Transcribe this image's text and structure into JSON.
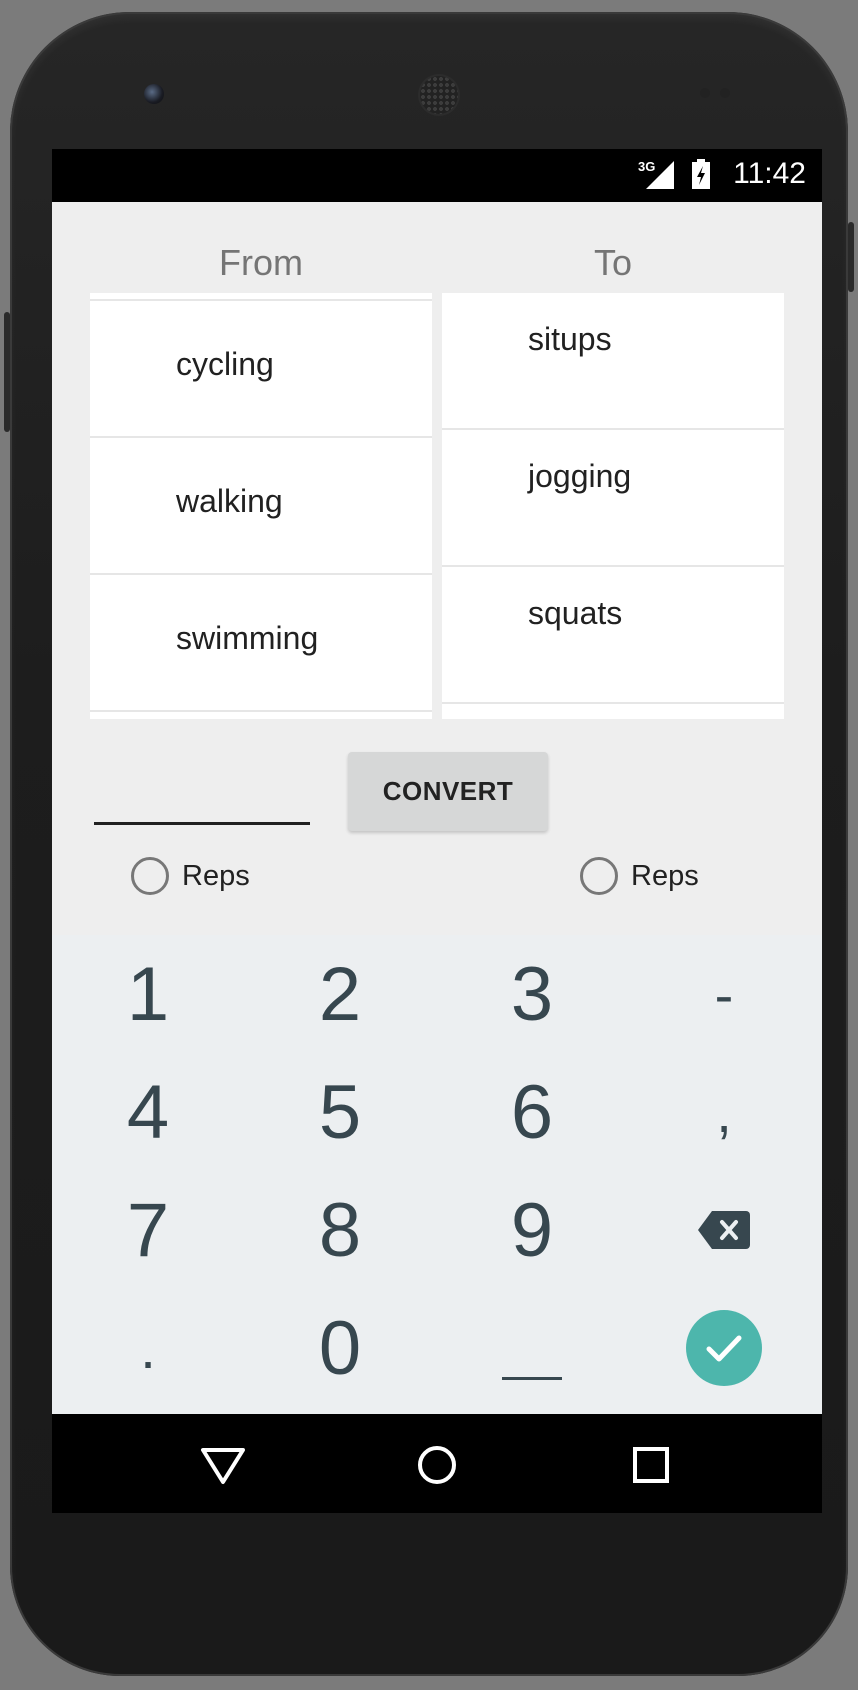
{
  "status_bar": {
    "network": "3G",
    "time": "11:42"
  },
  "converter": {
    "from_header": "From",
    "to_header": "To",
    "from_items": [
      "cycling",
      "walking",
      "swimming"
    ],
    "to_items": [
      "situps",
      "jogging",
      "squats"
    ],
    "amount_value": "",
    "convert_label": "CONVERT",
    "from_unit_label": "Reps",
    "to_unit_label": "Reps"
  },
  "keyboard": {
    "keys": [
      "1",
      "2",
      "3",
      "-",
      "4",
      "5",
      "6",
      ",",
      "7",
      "8",
      "9",
      "backspace",
      ".",
      "0",
      "space",
      "done"
    ],
    "accent_color": "#4db6ac"
  },
  "nav": {
    "buttons": [
      "back-icon",
      "home-icon",
      "recents-icon"
    ]
  }
}
